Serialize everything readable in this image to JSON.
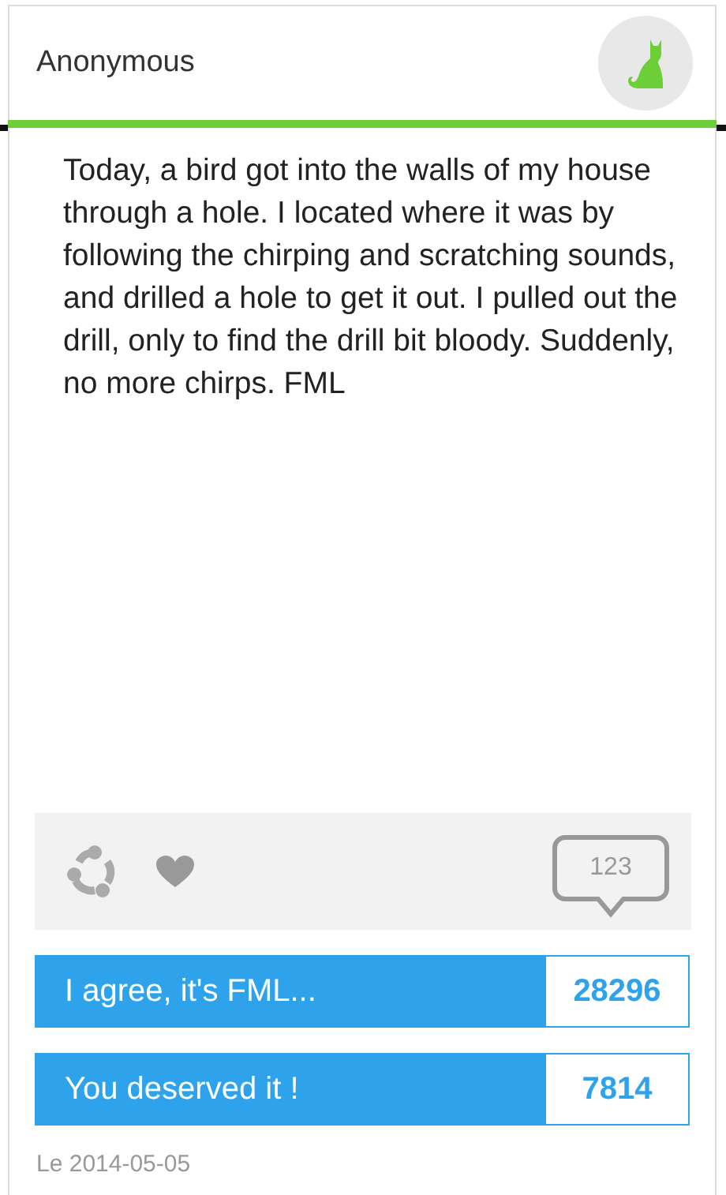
{
  "post": {
    "author": "Anonymous",
    "text": "Today, a bird got into the walls of my house through a hole. I located where it was by following the chirping and scratching sounds, and drilled a hole to get it out. I pulled out the drill, only to find the drill bit bloody. Suddenly, no more chirps. FML",
    "liked": false,
    "comments": "123",
    "date": "Le 2014-05-05"
  },
  "votes": [
    {
      "label": "I agree, it's FML...",
      "count": "28296"
    },
    {
      "label": "You deserved it !",
      "count": "7814"
    }
  ]
}
